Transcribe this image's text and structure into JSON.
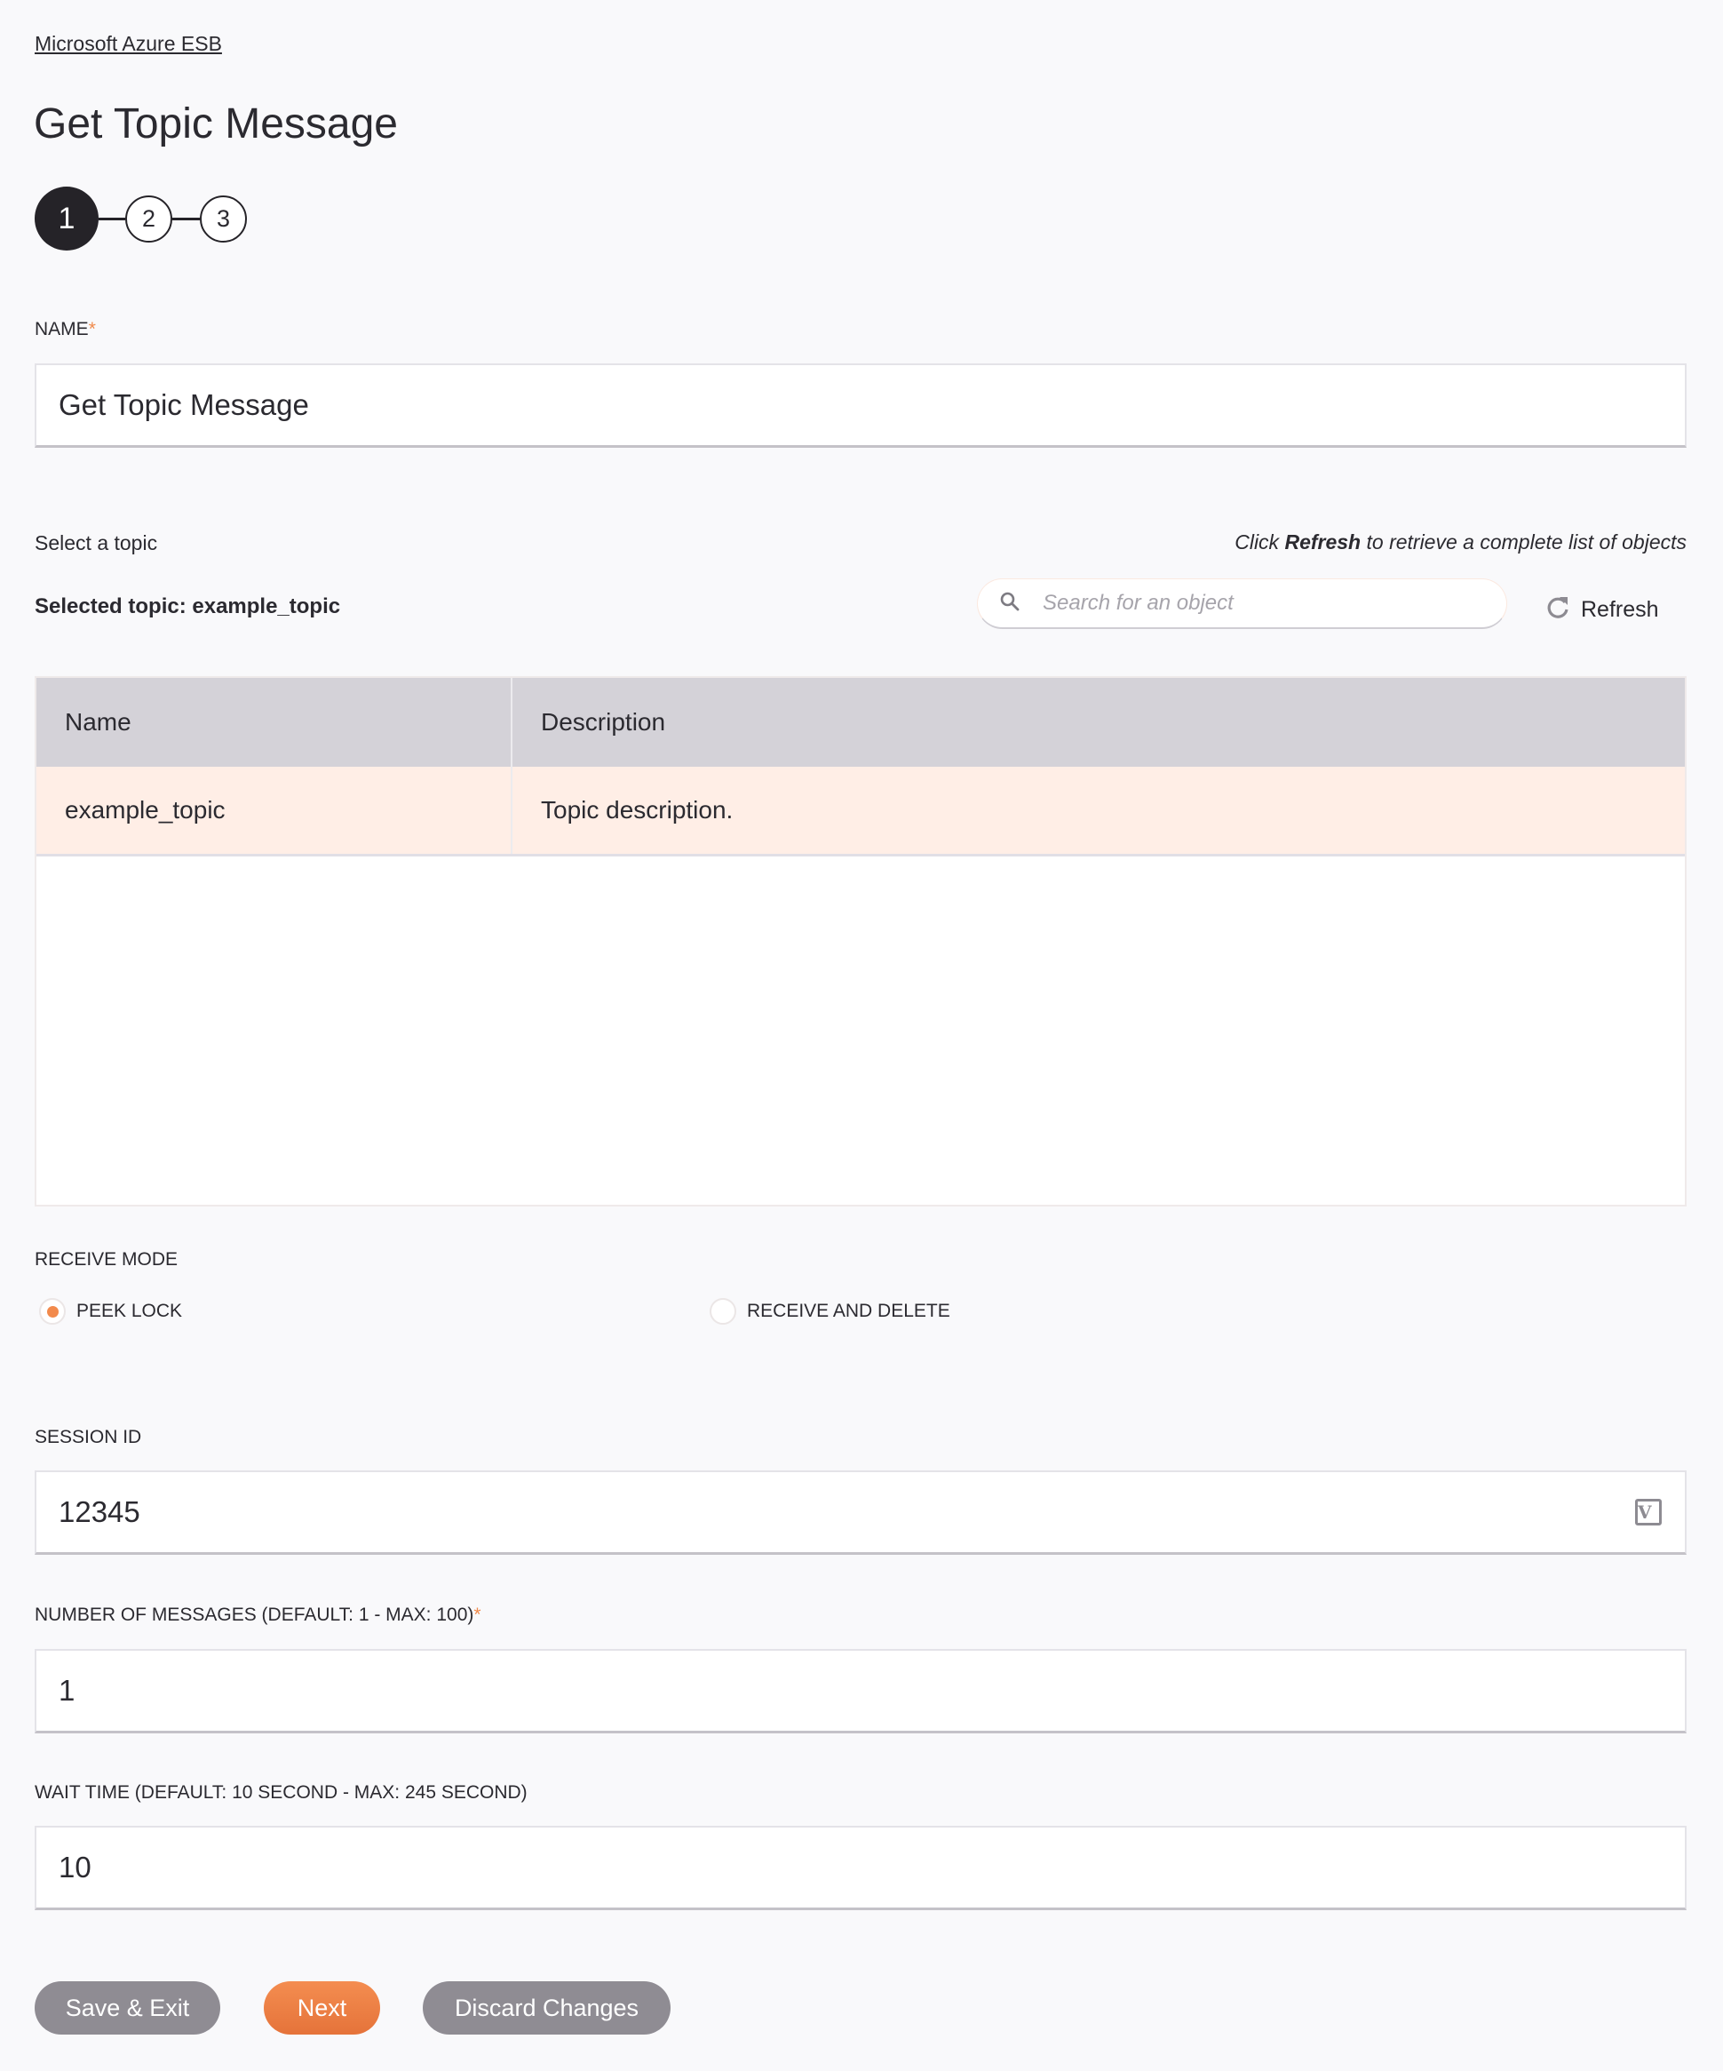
{
  "breadcrumb": "Microsoft Azure ESB",
  "page_title": "Get Topic Message",
  "stepper": {
    "steps": [
      "1",
      "2",
      "3"
    ],
    "active_step": 1
  },
  "name_field": {
    "label": "NAME",
    "required_mark": "*",
    "value": "Get Topic Message"
  },
  "topic_selector": {
    "label": "Select a topic",
    "selected_text": "Selected topic: example_topic",
    "hint_prefix": "Click ",
    "hint_bold": "Refresh",
    "hint_suffix": " to retrieve a complete list of objects",
    "search_placeholder": "Search for an object",
    "search_icon": "search-icon",
    "refresh_label": "Refresh",
    "refresh_icon": "refresh-icon",
    "table": {
      "columns": [
        "Name",
        "Description"
      ],
      "rows": [
        {
          "name": "example_topic",
          "description": "Topic description.",
          "selected": true
        }
      ]
    }
  },
  "receive_mode": {
    "label": "RECEIVE MODE",
    "options": [
      {
        "label": "PEEK LOCK",
        "selected": true
      },
      {
        "label": "RECEIVE AND DELETE",
        "selected": false
      }
    ]
  },
  "session_id": {
    "label": "SESSION ID",
    "value": "12345",
    "variable_icon": "variable-icon",
    "variable_icon_glyph": "V"
  },
  "number_of_messages": {
    "label": "NUMBER OF MESSAGES (DEFAULT: 1 - MAX: 100)",
    "required_mark": "*",
    "value": "1"
  },
  "wait_time": {
    "label": "WAIT TIME (DEFAULT: 10 SECOND - MAX: 245 SECOND)",
    "value": "10"
  },
  "buttons": {
    "save_exit": "Save & Exit",
    "next": "Next",
    "discard": "Discard Changes"
  },
  "colors": {
    "accent": "#f08a4b",
    "selected_row": "#ffeee6",
    "table_header": "#d4d2d8",
    "button_grey": "#8f8c93",
    "stepper_active": "#252328"
  }
}
